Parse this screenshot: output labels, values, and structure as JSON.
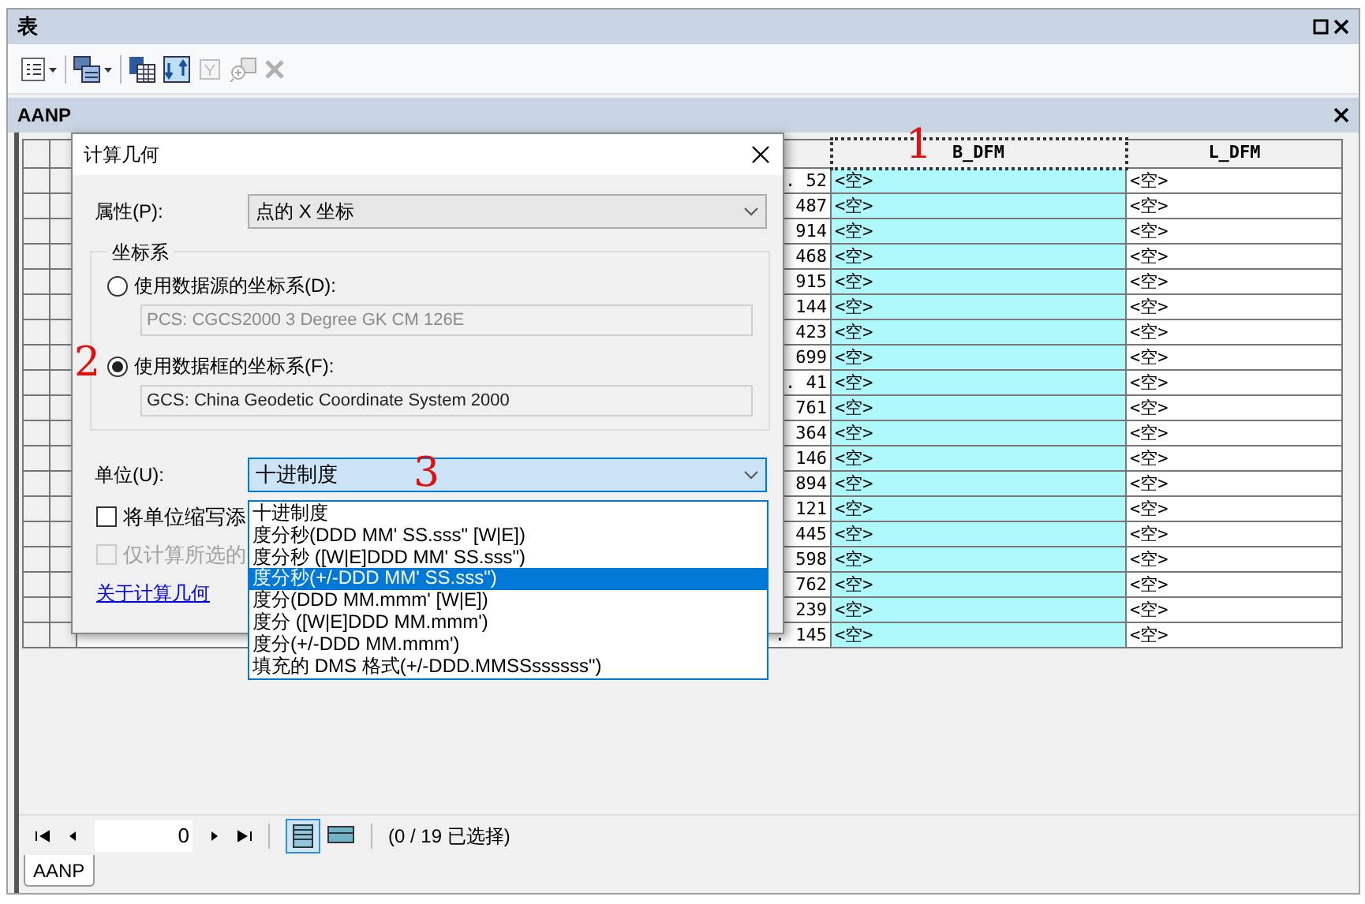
{
  "window": {
    "title": "表"
  },
  "table_title": "AANP",
  "table": {
    "columns": [
      {
        "label": "B_DFM",
        "selected": true
      },
      {
        "label": "L_DFM",
        "selected": false
      }
    ],
    "rows": [
      {
        "column_1": ". 52",
        "b_dfm": "<空>",
        "l_dfm": "<空>"
      },
      {
        "column_1": "487",
        "b_dfm": "<空>",
        "l_dfm": "<空>"
      },
      {
        "column_1": "914",
        "b_dfm": "<空>",
        "l_dfm": "<空>"
      },
      {
        "column_1": "468",
        "b_dfm": "<空>",
        "l_dfm": "<空>"
      },
      {
        "column_1": "915",
        "b_dfm": "<空>",
        "l_dfm": "<空>"
      },
      {
        "column_1": "144",
        "b_dfm": "<空>",
        "l_dfm": "<空>"
      },
      {
        "column_1": "423",
        "b_dfm": "<空>",
        "l_dfm": "<空>"
      },
      {
        "column_1": "699",
        "b_dfm": "<空>",
        "l_dfm": "<空>"
      },
      {
        "column_1": ". 41",
        "b_dfm": "<空>",
        "l_dfm": "<空>"
      },
      {
        "column_1": "761",
        "b_dfm": "<空>",
        "l_dfm": "<空>"
      },
      {
        "column_1": "364",
        "b_dfm": "<空>",
        "l_dfm": "<空>"
      },
      {
        "column_1": "146",
        "b_dfm": "<空>",
        "l_dfm": "<空>"
      },
      {
        "column_1": "894",
        "b_dfm": "<空>",
        "l_dfm": "<空>"
      },
      {
        "column_1": "121",
        "b_dfm": "<空>",
        "l_dfm": "<空>"
      },
      {
        "column_1": "445",
        "b_dfm": "<空>",
        "l_dfm": "<空>"
      },
      {
        "column_1": "598",
        "b_dfm": "<空>",
        "l_dfm": "<空>"
      },
      {
        "column_1": "762",
        "b_dfm": "<空>",
        "l_dfm": "<空>"
      },
      {
        "column_1": "239",
        "b_dfm": "<空>",
        "l_dfm": "<空>"
      },
      {
        "column_1": ". 145",
        "b_dfm": "<空>",
        "l_dfm": "<空>"
      }
    ]
  },
  "dialog": {
    "title": "计算几何",
    "property": {
      "label": "属性(P):",
      "value": "点的 X 坐标"
    },
    "coordinate_system": {
      "title": "坐标系",
      "options": [
        {
          "label": "使用数据源的坐标系(D):",
          "value": "PCS: CGCS2000 3 Degree GK CM 126E",
          "selected": false
        },
        {
          "label": "使用数据框的坐标系(F):",
          "value": "GCS: China Geodetic Coordinate System 2000",
          "selected": true
        }
      ]
    },
    "unit": {
      "label": "单位(U):",
      "value": "十进制度",
      "expanded": true,
      "options": [
        {
          "label": "十进制度",
          "highlighted": false
        },
        {
          "label": "度分秒(DDD MM' SS.sss\" [W|E])",
          "highlighted": false
        },
        {
          "label": "度分秒 ([W|E]DDD MM' SS.sss\")",
          "highlighted": false
        },
        {
          "label": "度分秒(+/-DDD MM' SS.sss\")",
          "highlighted": true
        },
        {
          "label": "度分(DDD MM.mmm' [W|E])",
          "highlighted": false
        },
        {
          "label": "度分 ([W|E]DDD MM.mmm')",
          "highlighted": false
        },
        {
          "label": "度分(+/-DDD MM.mmm')",
          "highlighted": false
        },
        {
          "label": "填充的 DMS 格式(+/-DDD.MMSSssssss\")",
          "highlighted": false
        }
      ]
    },
    "checkboxes": [
      {
        "label": "将单位缩写添",
        "checked": false,
        "disabled": false
      },
      {
        "label": "仅计算所选的",
        "checked": false,
        "disabled": true
      }
    ],
    "link": "关于计算几何"
  },
  "navigation": {
    "record": "0",
    "status": "(0 / 19 已选择)"
  },
  "bottom_tabs": [
    {
      "label": "AANP",
      "selected": true
    }
  ],
  "annotations": [
    {
      "text": "1"
    },
    {
      "text": "2"
    },
    {
      "text": "3"
    }
  ]
}
